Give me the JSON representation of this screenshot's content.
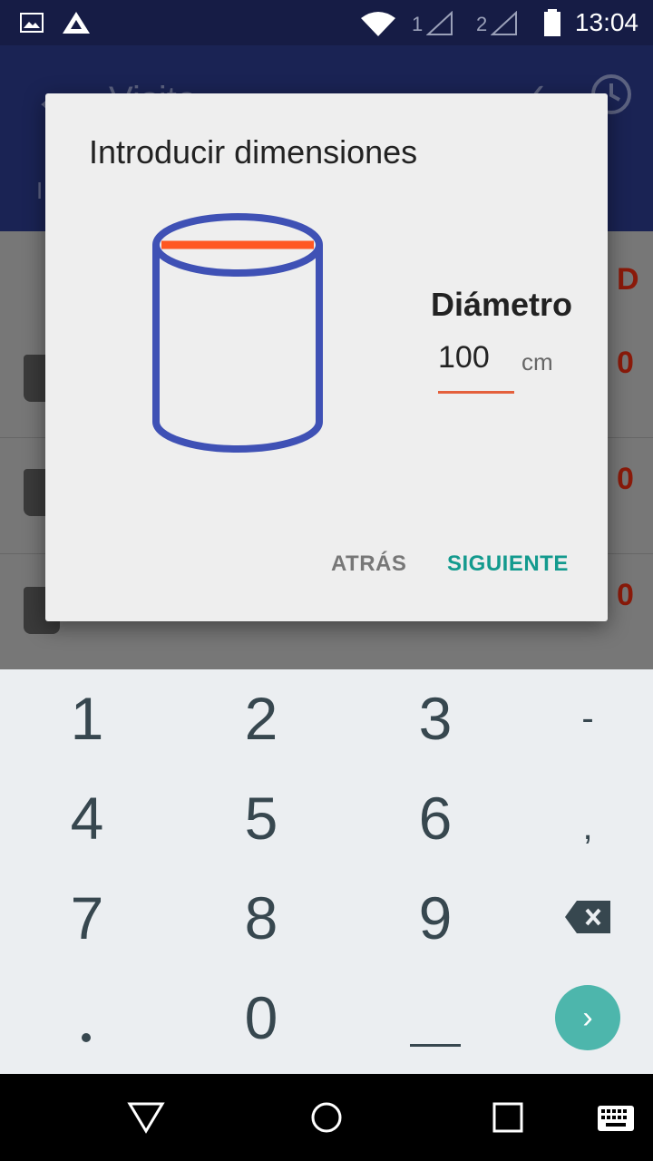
{
  "status_bar": {
    "time": "13:04",
    "sim1": "1",
    "sim2": "2",
    "icons": [
      "gallery-icon",
      "app-logo-icon",
      "wifi-icon",
      "signal-icon",
      "signal-icon",
      "battery-icon"
    ]
  },
  "app_bar": {
    "title": "Visita",
    "subtitle": "I"
  },
  "background_list": {
    "header_value": "D",
    "values": [
      "0",
      "0",
      "0"
    ]
  },
  "dialog": {
    "title": "Introducir dimensiones",
    "field_label": "Diámetro",
    "field_value": "100",
    "unit": "cm",
    "back_label": "ATRÁS",
    "next_label": "SIGUIENTE",
    "colors": {
      "cylinder": "#3f51b5",
      "highlight": "#ff5722",
      "accent": "#139a8e"
    }
  },
  "keyboard": {
    "keys": {
      "k1": "1",
      "k2": "2",
      "k3": "3",
      "minus": "-",
      "k4": "4",
      "k5": "5",
      "k6": "6",
      "comma": ",",
      "k7": "7",
      "k8": "8",
      "k9": "9",
      "k0": "0"
    }
  },
  "nav_bar": {
    "icons": [
      "back-triangle-icon",
      "home-circle-icon",
      "recents-square-icon",
      "keyboard-icon"
    ]
  }
}
